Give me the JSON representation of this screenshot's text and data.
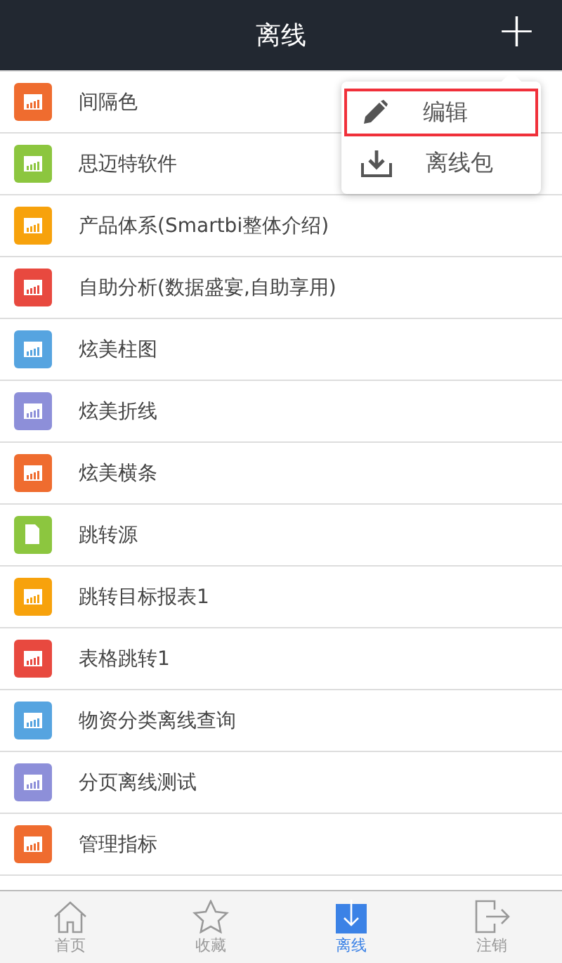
{
  "header": {
    "title": "离线",
    "add_button": "+"
  },
  "items": [
    {
      "label": "间隔色",
      "kind": "chart",
      "color": "#ef6c2f"
    },
    {
      "label": "思迈特软件",
      "kind": "chart",
      "color": "#8cc63f"
    },
    {
      "label": "产品体系(Smartbi整体介绍)",
      "kind": "chart",
      "color": "#f7a20c"
    },
    {
      "label": "自助分析(数据盛宴,自助享用)",
      "kind": "chart",
      "color": "#e8493f"
    },
    {
      "label": "炫美柱图",
      "kind": "chart",
      "color": "#56a4e0"
    },
    {
      "label": "炫美折线",
      "kind": "chart",
      "color": "#8d8fd9"
    },
    {
      "label": "炫美横条",
      "kind": "chart",
      "color": "#ef6c2f"
    },
    {
      "label": "跳转源",
      "kind": "document",
      "color": "#8cc63f"
    },
    {
      "label": "跳转目标报表1",
      "kind": "chart",
      "color": "#f7a20c"
    },
    {
      "label": "表格跳转1",
      "kind": "chart",
      "color": "#e8493f"
    },
    {
      "label": "物资分类离线查询",
      "kind": "chart",
      "color": "#56a4e0"
    },
    {
      "label": "分页离线测试",
      "kind": "chart",
      "color": "#8d8fd9"
    },
    {
      "label": "管理指标",
      "kind": "chart",
      "color": "#ef6c2f"
    }
  ],
  "menu": [
    {
      "label": "编辑",
      "kind": "edit",
      "selected": true
    },
    {
      "label": "离线包",
      "kind": "download",
      "selected": false
    }
  ],
  "tabs": [
    {
      "label": "首页",
      "kind": "home",
      "selected": false
    },
    {
      "label": "收藏",
      "kind": "star",
      "selected": false
    },
    {
      "label": "离线",
      "kind": "offline",
      "selected": true
    },
    {
      "label": "注销",
      "kind": "logout",
      "selected": false
    }
  ]
}
